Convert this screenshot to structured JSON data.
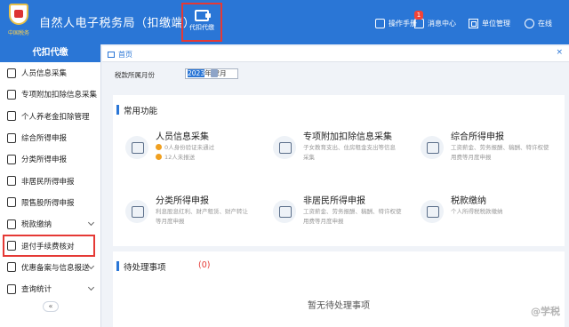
{
  "header": {
    "logo_text": "中国税务",
    "title": "自然人电子税务局（扣缴端）",
    "module": {
      "label": "代扣代缴",
      "icon": "wallet-icon"
    },
    "items": [
      {
        "label": "操作手册",
        "icon": "manual-icon"
      },
      {
        "label": "消息中心",
        "icon": "message-icon",
        "badge": "1"
      },
      {
        "label": "单位管理",
        "icon": "unit-icon"
      },
      {
        "label": "在线",
        "icon": "online-icon"
      }
    ]
  },
  "sidebar": {
    "title": "代扣代缴",
    "items": [
      {
        "label": "人员信息采集",
        "icon": "person-icon"
      },
      {
        "label": "专项附加扣除信息采集",
        "icon": "document-icon"
      },
      {
        "label": "个人养老金扣除管理",
        "icon": "pension-icon"
      },
      {
        "label": "综合所得申报",
        "icon": "report-icon"
      },
      {
        "label": "分类所得申报",
        "icon": "category-icon"
      },
      {
        "label": "非居民所得申报",
        "icon": "nonresident-icon"
      },
      {
        "label": "限售股所得申报",
        "icon": "stock-icon"
      },
      {
        "label": "税款缴纳",
        "icon": "payment-icon",
        "expandable": true
      },
      {
        "label": "退付手续费核对",
        "icon": "refund-icon",
        "highlighted": true
      },
      {
        "label": "优惠备案与信息报送",
        "icon": "filing-icon",
        "expandable": true
      },
      {
        "label": "查询统计",
        "icon": "query-icon",
        "expandable": true
      }
    ],
    "collapse": "«"
  },
  "tabbar": {
    "home": "首页",
    "close": "×"
  },
  "period": {
    "label": "税款所属月份",
    "year": "2023",
    "month": "年12月"
  },
  "common": {
    "title": "常用功能",
    "cards": [
      {
        "title": "人员信息采集",
        "icon": "person-card-icon",
        "warnings": [
          "0人身份验证未通过",
          "12人未报送"
        ]
      },
      {
        "title": "专项附加扣除信息采集",
        "icon": "deduction-card-icon",
        "desc": [
          "子女教育支出、住房租金支出等信息",
          "采集"
        ]
      },
      {
        "title": "综合所得申报",
        "icon": "income-card-icon",
        "desc": [
          "工资薪金、劳务报酬、稿酬、特许权使",
          "用费等月度申报"
        ]
      },
      {
        "title": "分类所得申报",
        "icon": "classified-card-icon",
        "desc": [
          "利息股息红利、财产租赁、财产转让",
          "等月度申报"
        ]
      },
      {
        "title": "非居民所得申报",
        "icon": "nonresident-card-icon",
        "desc": [
          "工资薪金、劳务报酬、稿酬、特许权使",
          "用费等月度申报"
        ]
      },
      {
        "title": "税款缴纳",
        "icon": "tax-payment-card-icon",
        "desc": [
          "个人所得税税款缴纳"
        ]
      }
    ]
  },
  "pending": {
    "title": "待处理事项",
    "count": "(0)",
    "empty": "暂无待处理事项"
  },
  "watermark": "@学税",
  "colors": {
    "primary": "#2a76d6",
    "highlight": "#e53935",
    "warning": "#f0a020"
  }
}
